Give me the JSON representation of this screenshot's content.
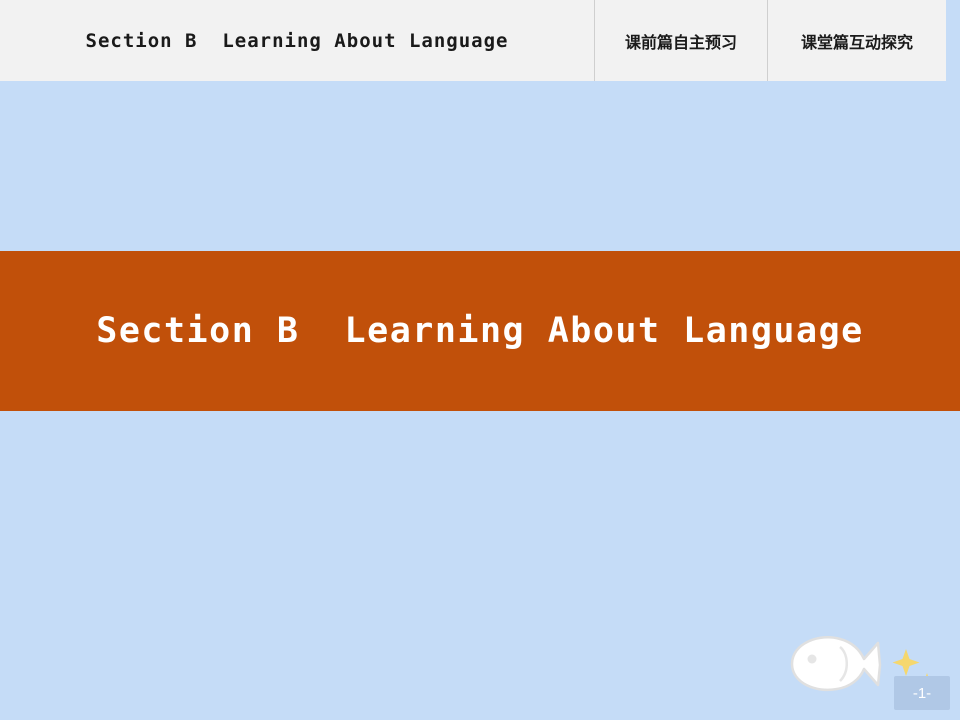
{
  "topbar": {
    "title": "Section B  Learning About Language",
    "tabs": [
      {
        "label": "课前篇自主预习"
      },
      {
        "label": "课堂篇互动探究"
      }
    ]
  },
  "band": {
    "title": "Section B  Learning About Language",
    "background_color": "#c1500a",
    "text_color": "#ffffff"
  },
  "slide": {
    "background_color": "#c5dcf7",
    "page_number": "-1-"
  },
  "decoration": {
    "fish_icon": "fish-icon",
    "star_icon": "star-icon",
    "fish_color": "#ffffff",
    "star_color": "#f5d76e"
  }
}
